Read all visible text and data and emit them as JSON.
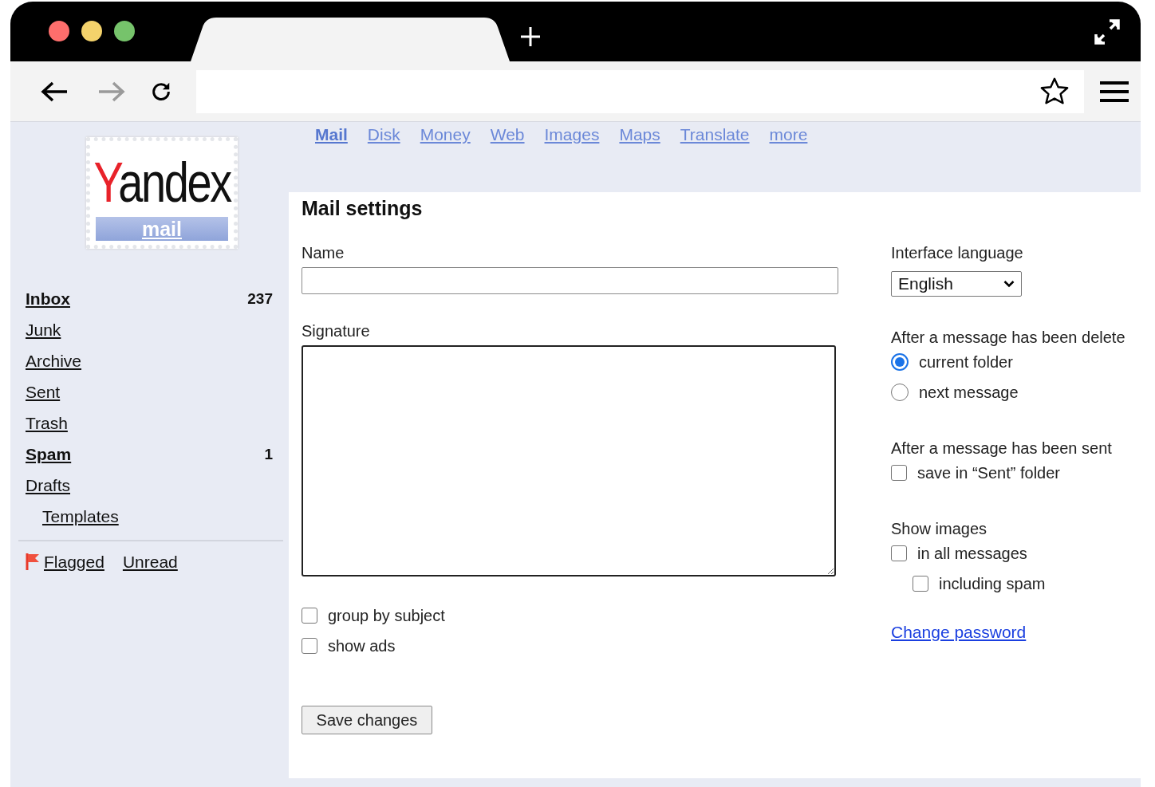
{
  "nav_buttons": [
    {
      "kind": "back",
      "disabled": false
    },
    {
      "kind": "forward",
      "disabled": true
    },
    {
      "kind": "reload",
      "disabled": false
    }
  ],
  "services": [
    {
      "label": "Mail",
      "selected": true
    },
    {
      "label": "Disk",
      "selected": false
    },
    {
      "label": "Money",
      "selected": false
    },
    {
      "label": "Web",
      "selected": false
    },
    {
      "label": "Images",
      "selected": false
    },
    {
      "label": "Maps",
      "selected": false
    },
    {
      "label": "Translate",
      "selected": false
    },
    {
      "label": "more",
      "selected": false
    }
  ],
  "logo": {
    "wordmark": "Yandex",
    "product": "mail"
  },
  "folders": [
    {
      "name": "Inbox",
      "count": "237",
      "unread": true
    },
    {
      "name": "Junk",
      "unread": false
    },
    {
      "name": "Archive",
      "unread": false
    },
    {
      "name": "Sent",
      "unread": false
    },
    {
      "name": "Trash",
      "unread": false
    },
    {
      "name": "Spam",
      "count": "1",
      "unread": true
    },
    {
      "name": "Drafts",
      "unread": false,
      "children": [
        {
          "name": "Templates",
          "unread": false
        }
      ]
    }
  ],
  "filters": [
    {
      "label": "Flagged",
      "kind": "flag"
    },
    {
      "label": "Unread",
      "kind": "plain"
    }
  ],
  "settings": {
    "title": "Mail settings",
    "name_field": {
      "label": "Name"
    },
    "signature_field": {
      "label": "Signature"
    },
    "options": [
      {
        "label": "group by subject",
        "checked": false
      },
      {
        "label": "show ads",
        "checked": false
      }
    ],
    "save_button": "Save changes",
    "language": {
      "label": "Interface language",
      "value": "English"
    },
    "groups": [
      {
        "kind": "radio",
        "title": "After a message has been delete",
        "options": [
          {
            "label": "current folder",
            "selected": true
          },
          {
            "label": "next message",
            "selected": false
          }
        ]
      },
      {
        "kind": "checkbox",
        "title": "After a message has been sent",
        "options": [
          {
            "label": "save in “Sent” folder",
            "checked": false
          }
        ]
      },
      {
        "kind": "checkbox",
        "title": "Show images",
        "options": [
          {
            "label": "in all messages",
            "checked": false,
            "children": [
              {
                "label": "including spam",
                "checked": false
              }
            ]
          }
        ]
      }
    ],
    "change_password": "Change password"
  }
}
